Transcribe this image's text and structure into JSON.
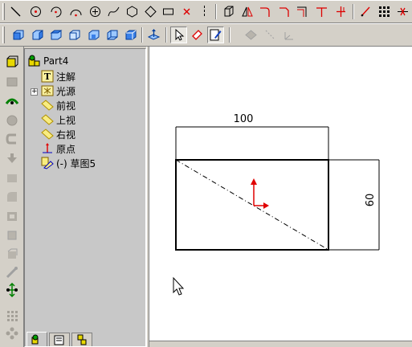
{
  "toolbar_top": {
    "buttons": [
      "line-icon",
      "circle-icon",
      "arc-icon",
      "tangent-arc-icon",
      "center-circle-icon",
      "spline-icon",
      "polygon-icon",
      "diamond-icon",
      "rectangle-icon",
      "point-icon",
      "centerline-icon",
      "box-icon",
      "mirror-icon",
      "fillet-icon",
      "chamfer-icon",
      "offset-icon",
      "trim-icon",
      "extend-icon",
      "smart-dimension-icon",
      "grid-icon",
      "relations-icon"
    ]
  },
  "toolbar_views": {
    "buttons": [
      "front-view-icon",
      "back-view-icon",
      "left-view-icon",
      "right-view-icon",
      "top-view-icon",
      "bottom-view-icon",
      "isometric-view-icon",
      "normal-to-icon",
      "select-icon",
      "sketch-icon",
      "edit-sketch-icon",
      "plane-icon",
      "axis-icon",
      "coordinate-system-icon"
    ]
  },
  "feature_tree": {
    "root": "Part4",
    "items": [
      {
        "label": "注解",
        "icon": "annotation-icon"
      },
      {
        "label": "光源",
        "icon": "lighting-icon"
      },
      {
        "label": "前视",
        "icon": "plane-icon"
      },
      {
        "label": "上视",
        "icon": "plane-icon"
      },
      {
        "label": "右视",
        "icon": "plane-icon"
      },
      {
        "label": "原点",
        "icon": "origin-icon"
      },
      {
        "label": "(-) 草图5",
        "icon": "sketch-icon"
      }
    ]
  },
  "sketch": {
    "width_dimension": "100",
    "height_dimension": "60"
  },
  "colors": {
    "origin": "#e00000",
    "selection": "#0000c0",
    "plane": "#d0b000"
  }
}
